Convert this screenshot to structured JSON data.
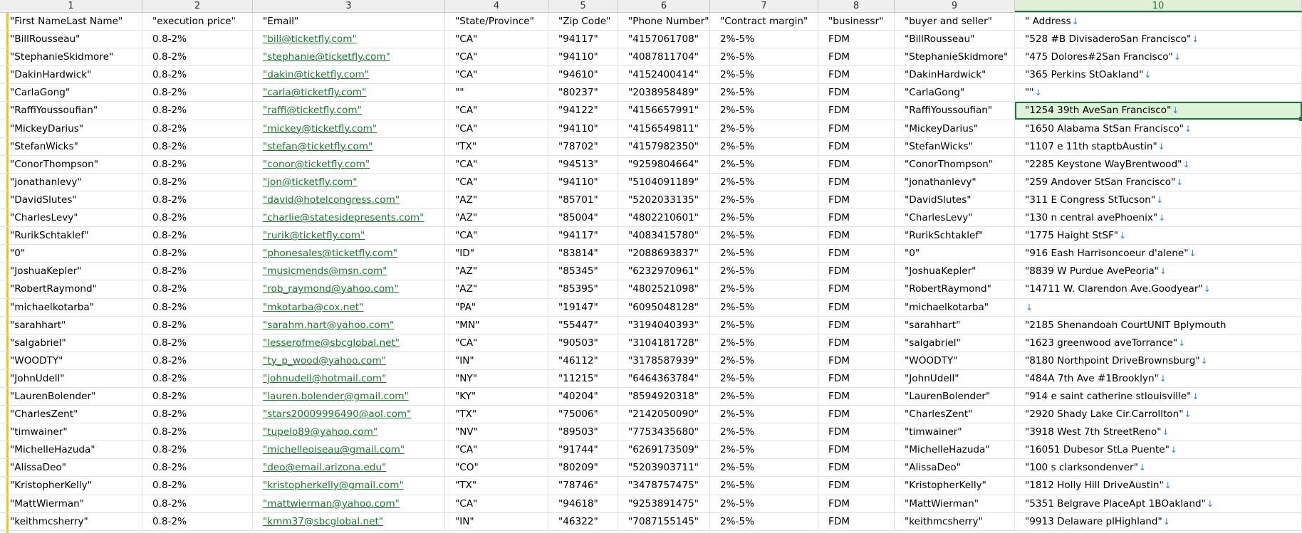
{
  "column_numbers": [
    "1",
    "2",
    "3",
    "4",
    "5",
    "6",
    "7",
    "8",
    "9",
    "10"
  ],
  "active_column": 9,
  "selected_cell": {
    "row": 5,
    "col": 9
  },
  "colors": {
    "link": "#1a7a2f",
    "arrow": "#2e7fd6",
    "accent": "#217346",
    "flag": "#f2c811"
  },
  "arrow_glyph": "↓",
  "rows": [
    [
      "\"First NameLast Name\"",
      "\"execution price\"",
      "\"Email\"",
      "\"State/Province\"",
      "\"Zip Code\"",
      "\"Phone Number\"",
      "\"Contract margin\"",
      "\"businessr\"",
      "\"buyer and seller\"",
      "\" Address"
    ],
    [
      "\"BillRousseau\"",
      "0.8-2%",
      "\"bill@ticketfly.com\"",
      "\"CA\"",
      "\"94117\"",
      "\"4157061708\"",
      "2%-5%",
      "FDM",
      "\"BillRousseau\"",
      "\"528 #B DivisaderoSan Francisco\""
    ],
    [
      "\"StephanieSkidmore\"",
      "0.8-2%",
      "\"stephanie@ticketfly.com\"",
      "\"CA\"",
      "\"94110\"",
      "\"4087811704\"",
      "2%-5%",
      "FDM",
      "\"StephanieSkidmore\"",
      "\"475 Dolores#2San Francisco\""
    ],
    [
      "\"DakinHardwick\"",
      "0.8-2%",
      "\"dakin@ticketfly.com\"",
      "\"CA\"",
      "\"94610\"",
      "\"4152400414\"",
      "2%-5%",
      "FDM",
      "\"DakinHardwick\"",
      "\"365 Perkins StOakland\""
    ],
    [
      "\"CarlaGong\"",
      "0.8-2%",
      "\"carla@ticketfly.com\"",
      "\"\"",
      "\"80237\"",
      "\"2038958489\"",
      "2%-5%",
      "FDM",
      "\"CarlaGong\"",
      "\"\""
    ],
    [
      "\"RaffiYoussoufian\"",
      "0.8-2%",
      "\"raffi@ticketfly.com\"",
      "\"CA\"",
      "\"94122\"",
      "\"4156657991\"",
      "2%-5%",
      "FDM",
      "\"RaffiYoussoufian\"",
      "\"1254 39th AveSan Francisco\""
    ],
    [
      "\"MickeyDarius\"",
      "0.8-2%",
      "\"mickey@ticketfly.com\"",
      "\"CA\"",
      "\"94110\"",
      "\"4156549811\"",
      "2%-5%",
      "FDM",
      "\"MickeyDarius\"",
      "\"1650 Alabama StSan Francisco\""
    ],
    [
      "\"StefanWicks\"",
      "0.8-2%",
      "\"stefan@ticketfly.com\"",
      "\"TX\"",
      "\"78702\"",
      "\"4157982350\"",
      "2%-5%",
      "FDM",
      "\"StefanWicks\"",
      "\"1107 e 11th staptbAustin\""
    ],
    [
      "\"ConorThompson\"",
      "0.8-2%",
      "\"conor@ticketfly.com\"",
      "\"CA\"",
      "\"94513\"",
      "\"9259804664\"",
      "2%-5%",
      "FDM",
      "\"ConorThompson\"",
      "\"2285 Keystone WayBrentwood\""
    ],
    [
      "\"jonathanlevy\"",
      "0.8-2%",
      "\"jon@ticketfly.com\"",
      "\"CA\"",
      "\"94110\"",
      "\"5104091189\"",
      "2%-5%",
      "FDM",
      "\"jonathanlevy\"",
      "\"259 Andover StSan Francisco\""
    ],
    [
      "\"DavidSlutes\"",
      "0.8-2%",
      "\"david@hotelcongress.com\"",
      "\"AZ\"",
      "\"85701\"",
      "\"5202033135\"",
      "2%-5%",
      "FDM",
      "\"DavidSlutes\"",
      "\"311 E Congress StTucson\""
    ],
    [
      "\"CharlesLevy\"",
      "0.8-2%",
      "\"charlie@statesidepresents.com\"",
      "\"AZ\"",
      "\"85004\"",
      "\"4802210601\"",
      "2%-5%",
      "FDM",
      "\"CharlesLevy\"",
      "\"130 n central avePhoenix\""
    ],
    [
      "\"RurikSchtaklef\"",
      "0.8-2%",
      "\"rurik@ticketfly.com\"",
      "\"CA\"",
      "\"94117\"",
      "\"4083415780\"",
      "2%-5%",
      "FDM",
      "\"RurikSchtaklef\"",
      "\"1775 Haight StSF\""
    ],
    [
      "\"0\"",
      "0.8-2%",
      "\"phonesales@ticketfly.com\"",
      "\"ID\"",
      "\"83814\"",
      "\"2088693837\"",
      "2%-5%",
      "FDM",
      "\"0\"",
      "\"916 Eash Harrisoncoeur d'alene\""
    ],
    [
      "\"JoshuaKepler\"",
      "0.8-2%",
      "\"musicmends@msn.com\"",
      "\"AZ\"",
      "\"85345\"",
      "\"6232970961\"",
      "2%-5%",
      "FDM",
      "\"JoshuaKepler\"",
      "\"8839 W Purdue AvePeoria\""
    ],
    [
      "\"RobertRaymond\"",
      "0.8-2%",
      "\"rob_raymond@yahoo.com\"",
      "\"AZ\"",
      "\"85395\"",
      "\"4802521098\"",
      "2%-5%",
      "FDM",
      "\"RobertRaymond\"",
      "\"14711 W. Clarendon Ave.Goodyear\""
    ],
    [
      "\"michaelkotarba\"",
      "0.8-2%",
      "\"mkotarba@cox.net\"",
      "\"PA\"",
      "\"19147\"",
      "\"6095048128\"",
      "2%-5%",
      "FDM",
      "\"michaelkotarba\"",
      ""
    ],
    [
      "\"sarahhart\"",
      "0.8-2%",
      "\"sarahm.hart@yahoo.com\"",
      "\"MN\"",
      "\"55447\"",
      "\"3194040393\"",
      "2%-5%",
      "FDM",
      "\"sarahhart\"",
      "\"2185 Shenandoah CourtUNIT Bplymouth"
    ],
    [
      "\"salgabriel\"",
      "0.8-2%",
      "\"lesserofme@sbcglobal.net\"",
      "\"CA\"",
      "\"90503\"",
      "\"3104181728\"",
      "2%-5%",
      "FDM",
      "\"salgabriel\"",
      "\"1623 greenwood aveTorrance\""
    ],
    [
      "\"WOODTY\"",
      "0.8-2%",
      "\"ty_p_wood@yahoo.com\"",
      "\"IN\"",
      "\"46112\"",
      "\"3178587939\"",
      "2%-5%",
      "FDM",
      "\"WOODTY\"",
      "\"8180 Northpoint DriveBrownsburg\""
    ],
    [
      "\"JohnUdell\"",
      "0.8-2%",
      "\"johnudell@hotmail.com\"",
      "\"NY\"",
      "\"11215\"",
      "\"6464363784\"",
      "2%-5%",
      "FDM",
      "\"JohnUdell\"",
      "\"484A 7th Ave #1Brooklyn\""
    ],
    [
      "\"LaurenBolender\"",
      "0.8-2%",
      "\"lauren.bolender@gmail.com\"",
      "\"KY\"",
      "\"40204\"",
      "\"8594920318\"",
      "2%-5%",
      "FDM",
      "\"LaurenBolender\"",
      "\"914 e saint catherine stlouisville\""
    ],
    [
      "\"CharlesZent\"",
      "0.8-2%",
      "\"stars20009996490@aol.com\"",
      "\"TX\"",
      "\"75006\"",
      "\"2142050090\"",
      "2%-5%",
      "FDM",
      "\"CharlesZent\"",
      "\"2920 Shady Lake Cir.Carrollton\""
    ],
    [
      "\"timwainer\"",
      "0.8-2%",
      "\"tupelo89@yahoo.com\"",
      "\"NV\"",
      "\"89503\"",
      "\"7753435680\"",
      "2%-5%",
      "FDM",
      "\"timwainer\"",
      "\"3918 West 7th StreetReno\""
    ],
    [
      "\"MichelleHazuda\"",
      "0.8-2%",
      "\"michelleoiseau@gmail.com\"",
      "\"CA\"",
      "\"91744\"",
      "\"6269173509\"",
      "2%-5%",
      "FDM",
      "\"MichelleHazuda\"",
      "\"16051 Dubesor StLa Puente\""
    ],
    [
      "\"AlissaDeo\"",
      "0.8-2%",
      "\"deo@email.arizona.edu\"",
      "\"CO\"",
      "\"80209\"",
      "\"5203903711\"",
      "2%-5%",
      "FDM",
      "\"AlissaDeo\"",
      "\"100 s clarksondenver\""
    ],
    [
      "\"KristopherKelly\"",
      "0.8-2%",
      "\"kristopherkelly@gmail.com\"",
      "\"TX\"",
      "\"78746\"",
      "\"3478757475\"",
      "2%-5%",
      "FDM",
      "\"KristopherKelly\"",
      "\"1812 Holly Hill DriveAustin\""
    ],
    [
      "\"MattWierman\"",
      "0.8-2%",
      "\"mattwierman@yahoo.com\"",
      "\"CA\"",
      "\"94618\"",
      "\"9253891475\"",
      "2%-5%",
      "FDM",
      "\"MattWierman\"",
      "\"5351 Belgrave PlaceApt 1BOakland\""
    ],
    [
      "\"keithmcsherry\"",
      "0.8-2%",
      "\"kmm37@sbcglobal.net\"",
      "\"IN\"",
      "\"46322\"",
      "\"7087155145\"",
      "2%-5%",
      "FDM",
      "\"keithmcsherry\"",
      "\"9913 Delaware plHighland\""
    ]
  ],
  "rows_with_arrow": [
    0,
    1,
    2,
    3,
    4,
    5,
    6,
    7,
    8,
    9,
    10,
    11,
    12,
    13,
    14,
    15,
    16,
    18,
    19,
    20,
    21,
    22,
    23,
    24,
    25,
    26,
    27,
    28
  ]
}
